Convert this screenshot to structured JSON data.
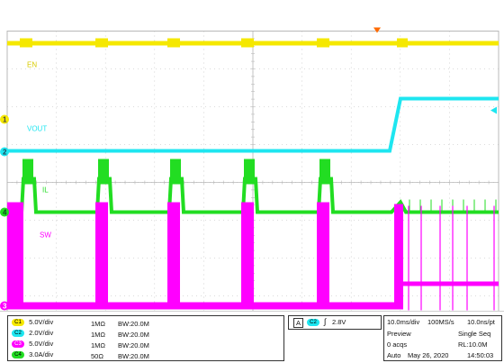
{
  "colors": {
    "ch1": "#f5e800",
    "ch2": "#1ee6f0",
    "ch3": "#ff00ff",
    "ch4": "#22dd22",
    "grid": "#b8b8b8",
    "trigger": "#ff6a00"
  },
  "traces": {
    "ch1_label": "EN",
    "ch2_label": "VOUT",
    "ch4_label": "IL",
    "ch3_label": "SW"
  },
  "markers": {
    "m1": "1",
    "m2": "2",
    "m4": "4",
    "m3": "3"
  },
  "channels": [
    {
      "pill": "C1",
      "scale": "5.0V/div",
      "impedance": "1MΩ",
      "bw": "BW:20.0M",
      "color": "#f5e800"
    },
    {
      "pill": "C2",
      "scale": "2.0V/div",
      "impedance": "1MΩ",
      "bw": "BW:20.0M",
      "color": "#1ee6f0"
    },
    {
      "pill": "C3",
      "scale": "5.0V/div",
      "impedance": "1MΩ",
      "bw": "BW:20.0M",
      "color": "#ff00ff"
    },
    {
      "pill": "C4",
      "scale": "3.0A/div",
      "impedance": "50Ω",
      "bw": "BW:20.0M",
      "color": "#22dd22"
    }
  ],
  "trigger": {
    "mode": "A",
    "source": "C2",
    "slope": "∫",
    "level": "2.8V"
  },
  "acquisition": {
    "timebase": "10.0ms/div",
    "rate": "100MS/s",
    "resolution": "10.0ns/pt",
    "state": "Preview",
    "sequence": "Single Seq",
    "acqs": "0 acqs",
    "record_length": "RL:10.0M",
    "trigger_mode": "Auto",
    "date": "May 26, 2020",
    "time": "14:50:03"
  }
}
